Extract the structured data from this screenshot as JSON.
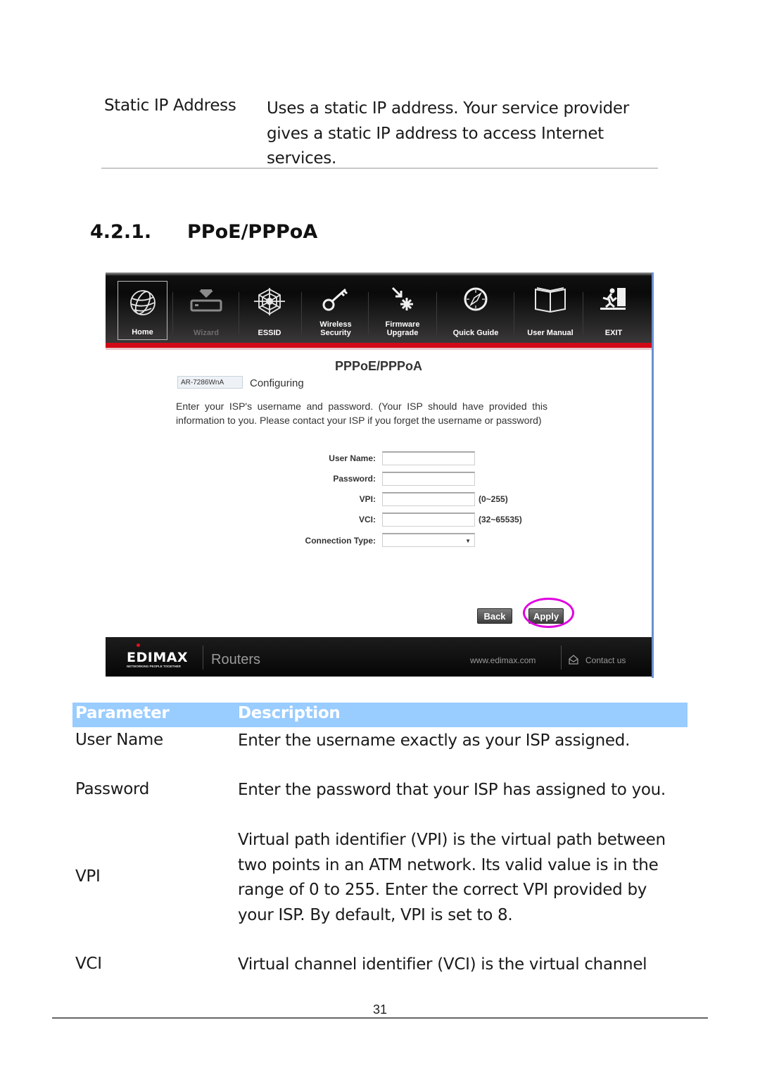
{
  "prev_table_row": {
    "parameter": "Static IP Address",
    "description": "Uses a static IP address. Your service provider gives a static IP address to access Internet services."
  },
  "section": {
    "number": "4.2.1.",
    "title": "PPoE/PPPoA"
  },
  "screenshot": {
    "nav": [
      {
        "label": "Home",
        "icon": "globe-icon"
      },
      {
        "label": "Wizard",
        "icon": "wizard-router-icon"
      },
      {
        "label": "ESSID",
        "icon": "web-icon"
      },
      {
        "label": "Wireless Security",
        "icon": "key-icon"
      },
      {
        "label": "Firmware Upgrade",
        "icon": "firmware-icon"
      },
      {
        "label": "Quick Guide",
        "icon": "compass-icon"
      },
      {
        "label": "User Manual",
        "icon": "book-icon"
      },
      {
        "label": "EXIT",
        "icon": "exit-icon"
      }
    ],
    "accent_color": "#d20a17",
    "form_title": "PPPoE/PPPoA",
    "model": "AR-7286WnA",
    "configuring_label": "Configuring",
    "intro": "Enter your ISP's username and password. (Your ISP should have provided this information to you. Please contact your ISP if you forget the username or password)",
    "fields": {
      "user_name": {
        "label": "User Name:",
        "value": ""
      },
      "password": {
        "label": "Password:",
        "value": ""
      },
      "vpi": {
        "label": "VPI:",
        "value": "",
        "hint": "(0~255)"
      },
      "vci": {
        "label": "VCI:",
        "value": "",
        "hint": "(32~65535)"
      },
      "connection_type": {
        "label": "Connection Type:",
        "value": ""
      }
    },
    "buttons": {
      "back": "Back",
      "apply": "Apply"
    },
    "highlight_color": "#e000e0",
    "footer": {
      "brand": "EDIMAX",
      "tagline": "NETWORKING PEOPLE TOGETHER",
      "product": "Routers",
      "website": "www.edimax.com",
      "contact": "Contact us"
    }
  },
  "param_table": {
    "header_color": "#99ccff",
    "headers": {
      "parameter": "Parameter",
      "description": "Description"
    },
    "rows": [
      {
        "parameter": "User Name",
        "description": "Enter the username exactly as your ISP assigned."
      },
      {
        "parameter": "Password",
        "description": "Enter the password that your ISP has assigned to you."
      },
      {
        "parameter": "VPI",
        "description": "Virtual path identifier (VPI) is the virtual path between two points in an ATM network. Its valid value is in the range of 0 to 255. Enter the correct VPI provided by your ISP. By default, VPI is set to 8."
      },
      {
        "parameter": "VCI",
        "description": "Virtual channel identifier (VCI) is the virtual channel"
      }
    ]
  },
  "page_number": "31"
}
